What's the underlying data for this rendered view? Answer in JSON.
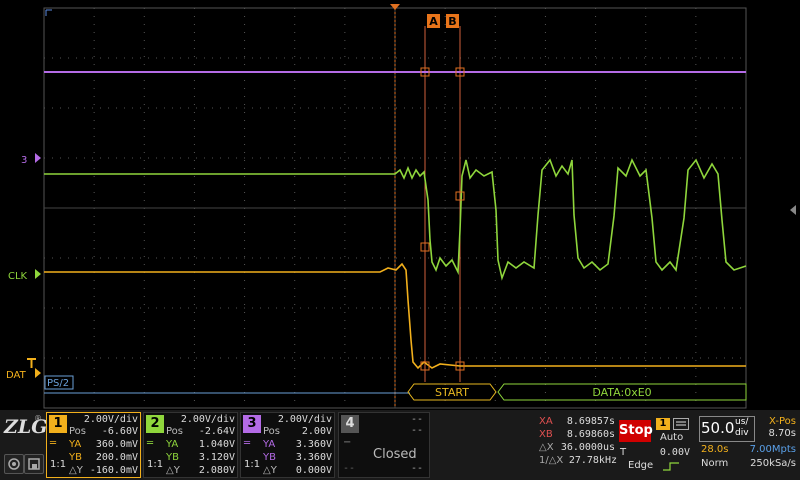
{
  "signals": {
    "purple_marker": "3",
    "green_label": "CLK",
    "orange_label": "DAT",
    "bus_label": "PS/2",
    "bus_start": "START",
    "bus_data": "DATA:0xE0",
    "cursor_a": "A",
    "cursor_b": "B"
  },
  "channels": [
    {
      "num": "1",
      "color": "#f2b01c",
      "vdiv": "2.00V/div",
      "pos_label": "Pos",
      "pos": "-6.60V",
      "ya_label": "YA",
      "ya": "360.0mV",
      "yb_label": "YB",
      "yb": "200.0mV",
      "dy_label": "△Y",
      "dy": "-160.0mV",
      "coupling": "1:1"
    },
    {
      "num": "2",
      "color": "#8fd63c",
      "vdiv": "2.00V/div",
      "pos_label": "Pos",
      "pos": "-2.64V",
      "ya_label": "YA",
      "ya": "1.040V",
      "yb_label": "YB",
      "yb": "3.120V",
      "dy_label": "△Y",
      "dy": "2.080V",
      "coupling": "1:1"
    },
    {
      "num": "3",
      "color": "#b46be6",
      "vdiv": "2.00V/div",
      "pos_label": "Pos",
      "pos": "2.00V",
      "ya_label": "YA",
      "ya": "3.360V",
      "yb_label": "YB",
      "yb": "3.360V",
      "dy_label": "△Y",
      "dy": "0.000V",
      "coupling": "1:1"
    }
  ],
  "ch4": {
    "num": "4",
    "status": "Closed",
    "dash1": "--",
    "dash2": "--",
    "dash3": "--",
    "dash4": "--"
  },
  "cursors": {
    "xa_label": "XA",
    "xa": "8.69857s",
    "xb_label": "XB",
    "xb": "8.69860s",
    "dx_label": "△X",
    "dx": "36.0000us",
    "inv_label": "1/△X",
    "inv": "27.78kHz"
  },
  "run": {
    "state": "Stop"
  },
  "trigger": {
    "source": "1",
    "mode": "Auto",
    "t_label": "T",
    "level": "0.00V",
    "type": "Edge"
  },
  "timebase": {
    "value": "50.0",
    "unit_top": "us/",
    "unit_bot": "div",
    "xpos_label": "X-Pos",
    "xpos": "8.70s",
    "acq_time": "28.0s",
    "points": "7.00Mpts",
    "mode": "Norm",
    "rate": "250kSa/s"
  },
  "brand": "ZLG"
}
